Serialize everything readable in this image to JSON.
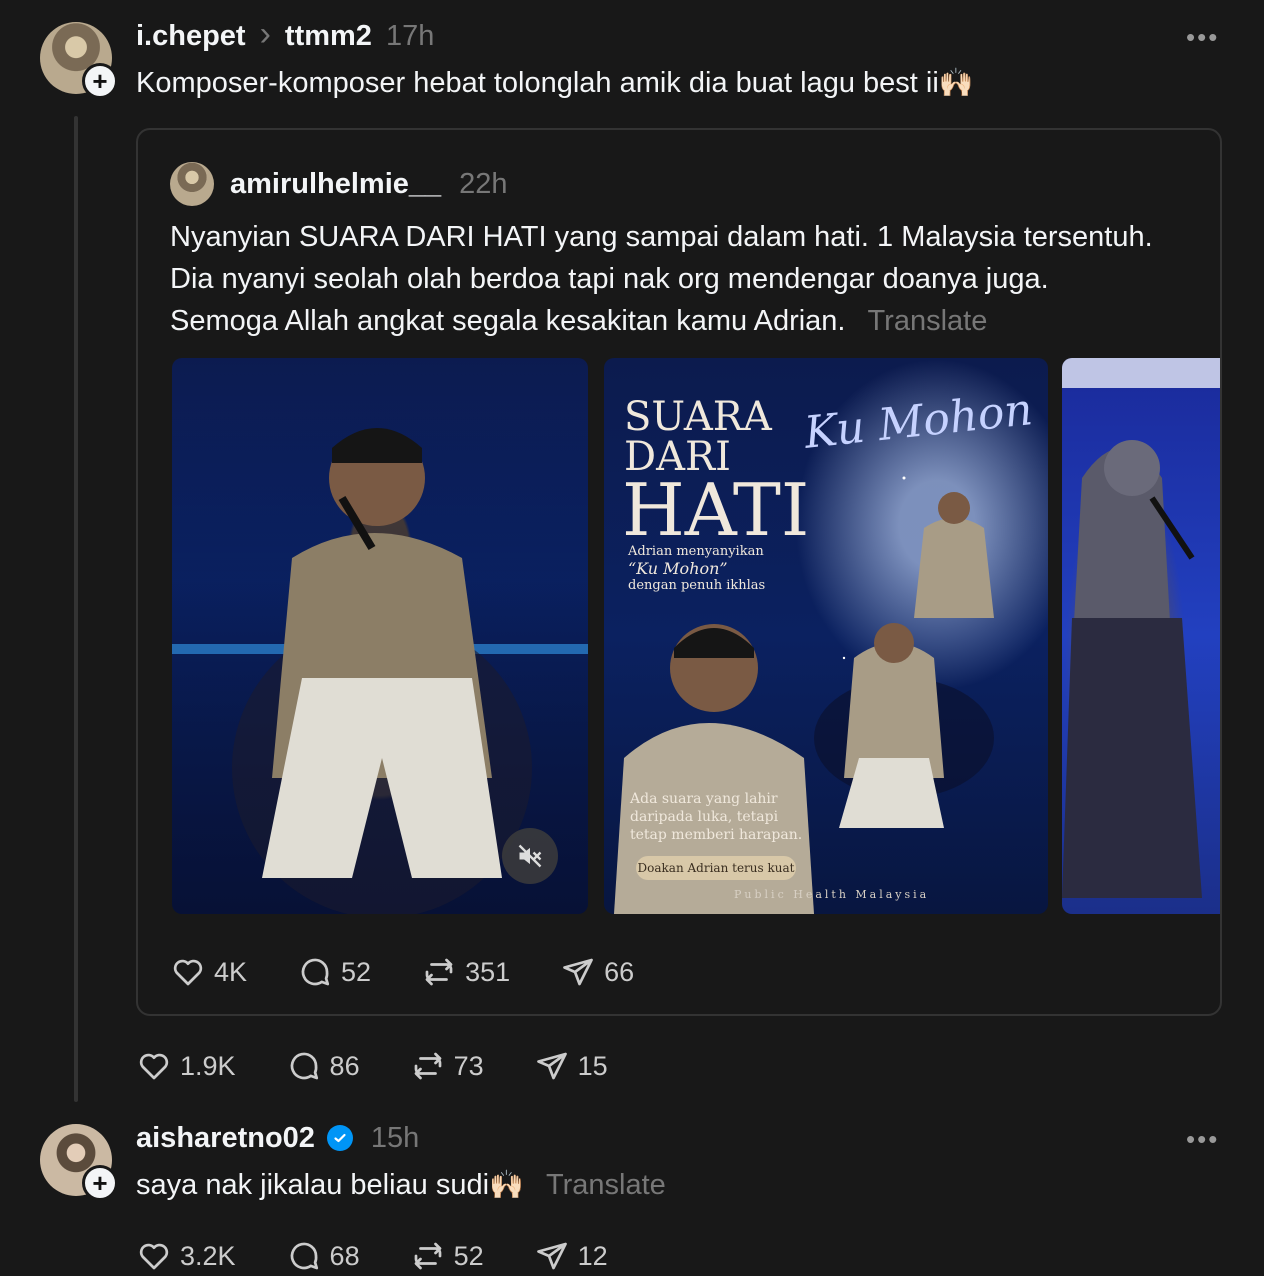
{
  "post": {
    "username": "i.chepet",
    "reply_to": "ttmm2",
    "time": "17h",
    "text": "Komposer-komposer hebat tolonglah amik dia buat lagu best ii",
    "emoji": "🙌🏻",
    "actions": {
      "likes": "1.9K",
      "comments": "86",
      "reposts": "73",
      "shares": "15"
    }
  },
  "quoted": {
    "username": "amirulhelmie__",
    "time": "22h",
    "lines": [
      "Nyanyian SUARA DARI HATI yang sampai dalam hati. 1 Malaysia tersentuh.",
      "Dia nyanyi seolah olah berdoa tapi nak org mendengar doanya juga.",
      "Semoga Allah angkat segala kesakitan kamu Adrian."
    ],
    "translate": "Translate",
    "poster": {
      "title1": "SUARA",
      "title2": "DARI",
      "title3": "HATI",
      "script": "Ku Mohon",
      "sub1": "Adrian menyanyikan",
      "sub2": "“Ku Mohon”",
      "sub3": "dengan penuh ikhlas",
      "quote1": "Ada suara yang lahir",
      "quote2": "daripada luka, tetapi",
      "quote3": "tetap memberi harapan.",
      "pill": "Doakan Adrian terus kuat",
      "footer": "Public Health Malaysia"
    },
    "actions": {
      "likes": "4K",
      "comments": "52",
      "reposts": "351",
      "shares": "66"
    }
  },
  "reply": {
    "username": "aisharetno02",
    "time": "15h",
    "text": "saya nak jikalau beliau sudi",
    "emoji": "🙌🏻",
    "translate": "Translate",
    "actions": {
      "likes": "3.2K",
      "comments": "68",
      "reposts": "52",
      "shares": "12"
    }
  },
  "menu_glyph": "•••",
  "chevron_glyph": "›",
  "colors": {
    "background": "#181818",
    "text": "#f3f5f7",
    "muted": "#777777",
    "border": "#333333",
    "verified": "#0095f6"
  }
}
